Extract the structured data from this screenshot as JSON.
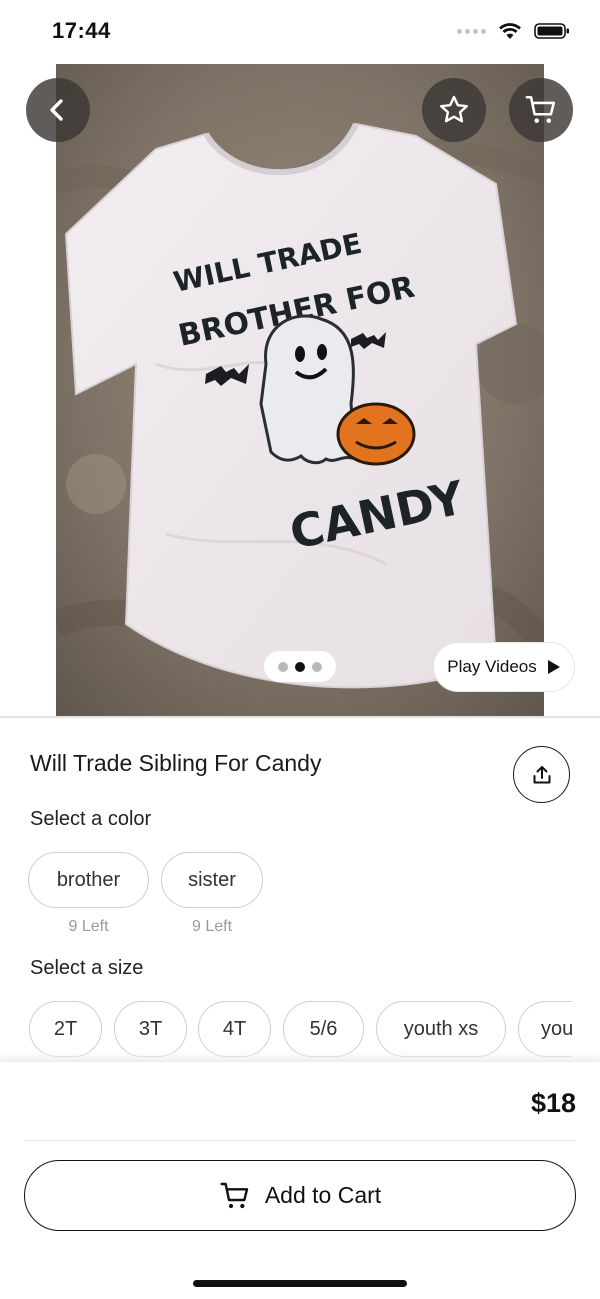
{
  "status_bar": {
    "time": "17:44",
    "icons": [
      "signal-dots-icon",
      "wifi-icon",
      "battery-icon"
    ]
  },
  "hero": {
    "print_line_1": "WILL TRADE",
    "print_line_2": "BROTHER FOR",
    "print_line_3": "CANDY",
    "pager": {
      "count": 3,
      "active_index": 1
    },
    "play_videos_label": "Play Videos",
    "icons": {
      "back": "chevron-left-icon",
      "favorite": "star-outline-icon",
      "cart": "cart-icon",
      "play": "play-icon"
    }
  },
  "product": {
    "title": "Will Trade Sibling For Candy",
    "share_icon": "share-icon",
    "color_label": "Select a color",
    "colors": [
      {
        "label": "brother",
        "stock": "9 Left"
      },
      {
        "label": "sister",
        "stock": "9 Left"
      }
    ],
    "size_label": "Select a size",
    "sizes": [
      "2T",
      "3T",
      "4T",
      "5/6",
      "youth xs",
      "you"
    ]
  },
  "checkout": {
    "price": "$18",
    "add_to_cart_label": "Add to Cart"
  },
  "colors": {
    "overlay_button": "#3c3834",
    "text": "#111111",
    "muted": "#9a9a9a",
    "chip_border": "#cfcfcf",
    "pumpkin": "#e2731f"
  }
}
